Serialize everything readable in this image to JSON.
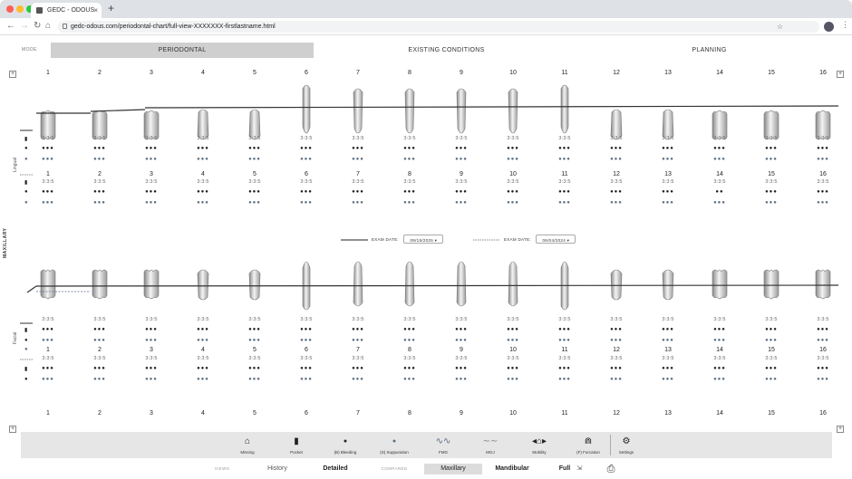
{
  "browser": {
    "tab_title": "GEDC - ODOUS",
    "tab_close": "×",
    "new_tab": "+",
    "url": "gedc-odous.com/periodontal-chart/full-view-XXXXXXX-firstlastname.html",
    "traffic_colors": [
      "#ff5f57",
      "#febc2e",
      "#28c840"
    ]
  },
  "mode": {
    "label": "MODE",
    "tabs": [
      {
        "label": "PERIODONTAL",
        "active": true
      },
      {
        "label": "EXISTING CONDITIONS",
        "active": false
      },
      {
        "label": "PLANNING",
        "active": false
      }
    ]
  },
  "chart": {
    "arch_label": "MAXILLARY",
    "upper_side_label": "Lingual",
    "lower_side_label": "Facial",
    "tooth_numbers": [
      "1",
      "2",
      "3",
      "4",
      "5",
      "6",
      "7",
      "8",
      "9",
      "10",
      "11",
      "12",
      "13",
      "14",
      "15",
      "16"
    ],
    "pocket_text": "3:3:5",
    "drops_text": "●●●",
    "single_drop": "●●",
    "exam1": {
      "label": "EXAM DATE:",
      "date": "09/15/2025",
      "arrow": "▾"
    },
    "exam2": {
      "label": "EXAM DATE:",
      "date": "06/04/2024",
      "arrow": "▾"
    },
    "expand": "+"
  },
  "toolbar": {
    "tools": [
      {
        "label": "Missing",
        "icon": "missing-tooth-icon",
        "glyph": "⌂"
      },
      {
        "label": "Pocket",
        "icon": "pocket-icon",
        "glyph": "▮"
      },
      {
        "label": "(B) Bleeding",
        "icon": "bleeding-drop-icon",
        "glyph": "●"
      },
      {
        "label": "(S) Suppuration",
        "icon": "suppuration-drop-icon",
        "glyph": "●"
      },
      {
        "label": "FMG",
        "icon": "fmg-wave-icon",
        "glyph": "∿∿"
      },
      {
        "label": "MGJ",
        "icon": "mgj-wave-icon",
        "glyph": "∼∼"
      },
      {
        "label": "Mobility",
        "icon": "mobility-tooth-icon",
        "glyph": "◂⌂▸"
      },
      {
        "label": "(F) Furcation",
        "icon": "furcation-tooth-icon",
        "glyph": "⋒"
      },
      {
        "label": "Settings",
        "icon": "settings-gear-icon",
        "glyph": "⚙"
      }
    ]
  },
  "views": {
    "label": "VIEWS",
    "history": "History",
    "detailed": "Detailed",
    "compared": "COMPARED",
    "maxillary": "Maxillary",
    "mandibular": "Mandibular",
    "full": "Full",
    "print_icon": "⎙",
    "full_icon": "⇲"
  }
}
